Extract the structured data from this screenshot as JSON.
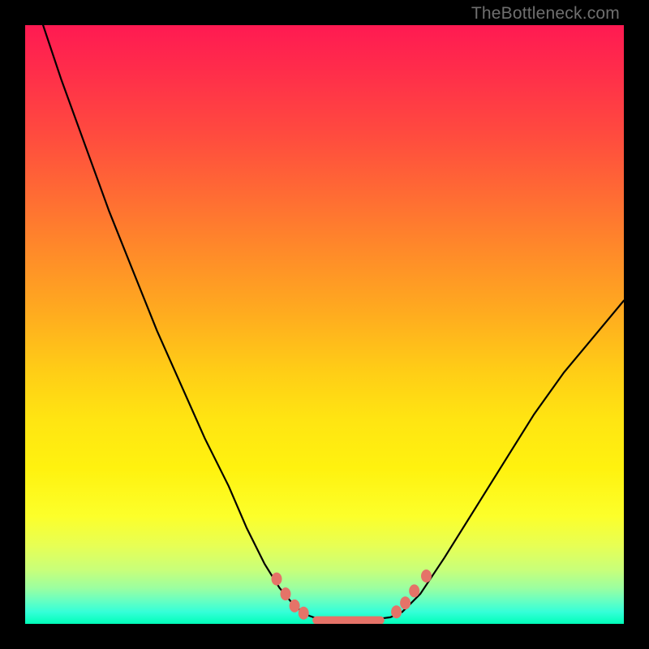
{
  "watermark": "TheBottleneck.com",
  "chart_data": {
    "type": "line",
    "title": "",
    "xlabel": "",
    "ylabel": "",
    "xlim": [
      0,
      100
    ],
    "ylim": [
      0,
      100
    ],
    "series": [
      {
        "name": "curve-left",
        "x": [
          3,
          6,
          10,
          14,
          18,
          22,
          26,
          30,
          34,
          37,
          40,
          42.5,
          45,
          47
        ],
        "y": [
          100,
          91,
          80,
          69,
          59,
          49,
          40,
          31,
          23,
          16,
          10,
          6,
          3,
          1.5
        ]
      },
      {
        "name": "curve-valley",
        "x": [
          47,
          49,
          52,
          55,
          58,
          61,
          63
        ],
        "y": [
          1.5,
          0.8,
          0.5,
          0.5,
          0.7,
          1.1,
          2
        ]
      },
      {
        "name": "curve-right",
        "x": [
          63,
          66,
          70,
          75,
          80,
          85,
          90,
          95,
          100
        ],
        "y": [
          2,
          5,
          11,
          19,
          27,
          35,
          42,
          48,
          54
        ]
      }
    ],
    "markers": {
      "left_cluster_x": [
        42,
        43.5,
        45,
        46.5
      ],
      "left_cluster_y": [
        7.5,
        5,
        3,
        1.8
      ],
      "right_cluster_x": [
        62,
        63.5,
        65,
        67
      ],
      "right_cluster_y": [
        2,
        3.5,
        5.5,
        8
      ],
      "bottom_bar": {
        "x0": 48,
        "x1": 60,
        "y": 0.6
      }
    },
    "colors": {
      "top": "#ff1a52",
      "mid": "#ffce16",
      "bottom": "#00ffb9",
      "marker": "#e57368",
      "frame": "#000000",
      "watermark": "#6f6f6f"
    }
  }
}
